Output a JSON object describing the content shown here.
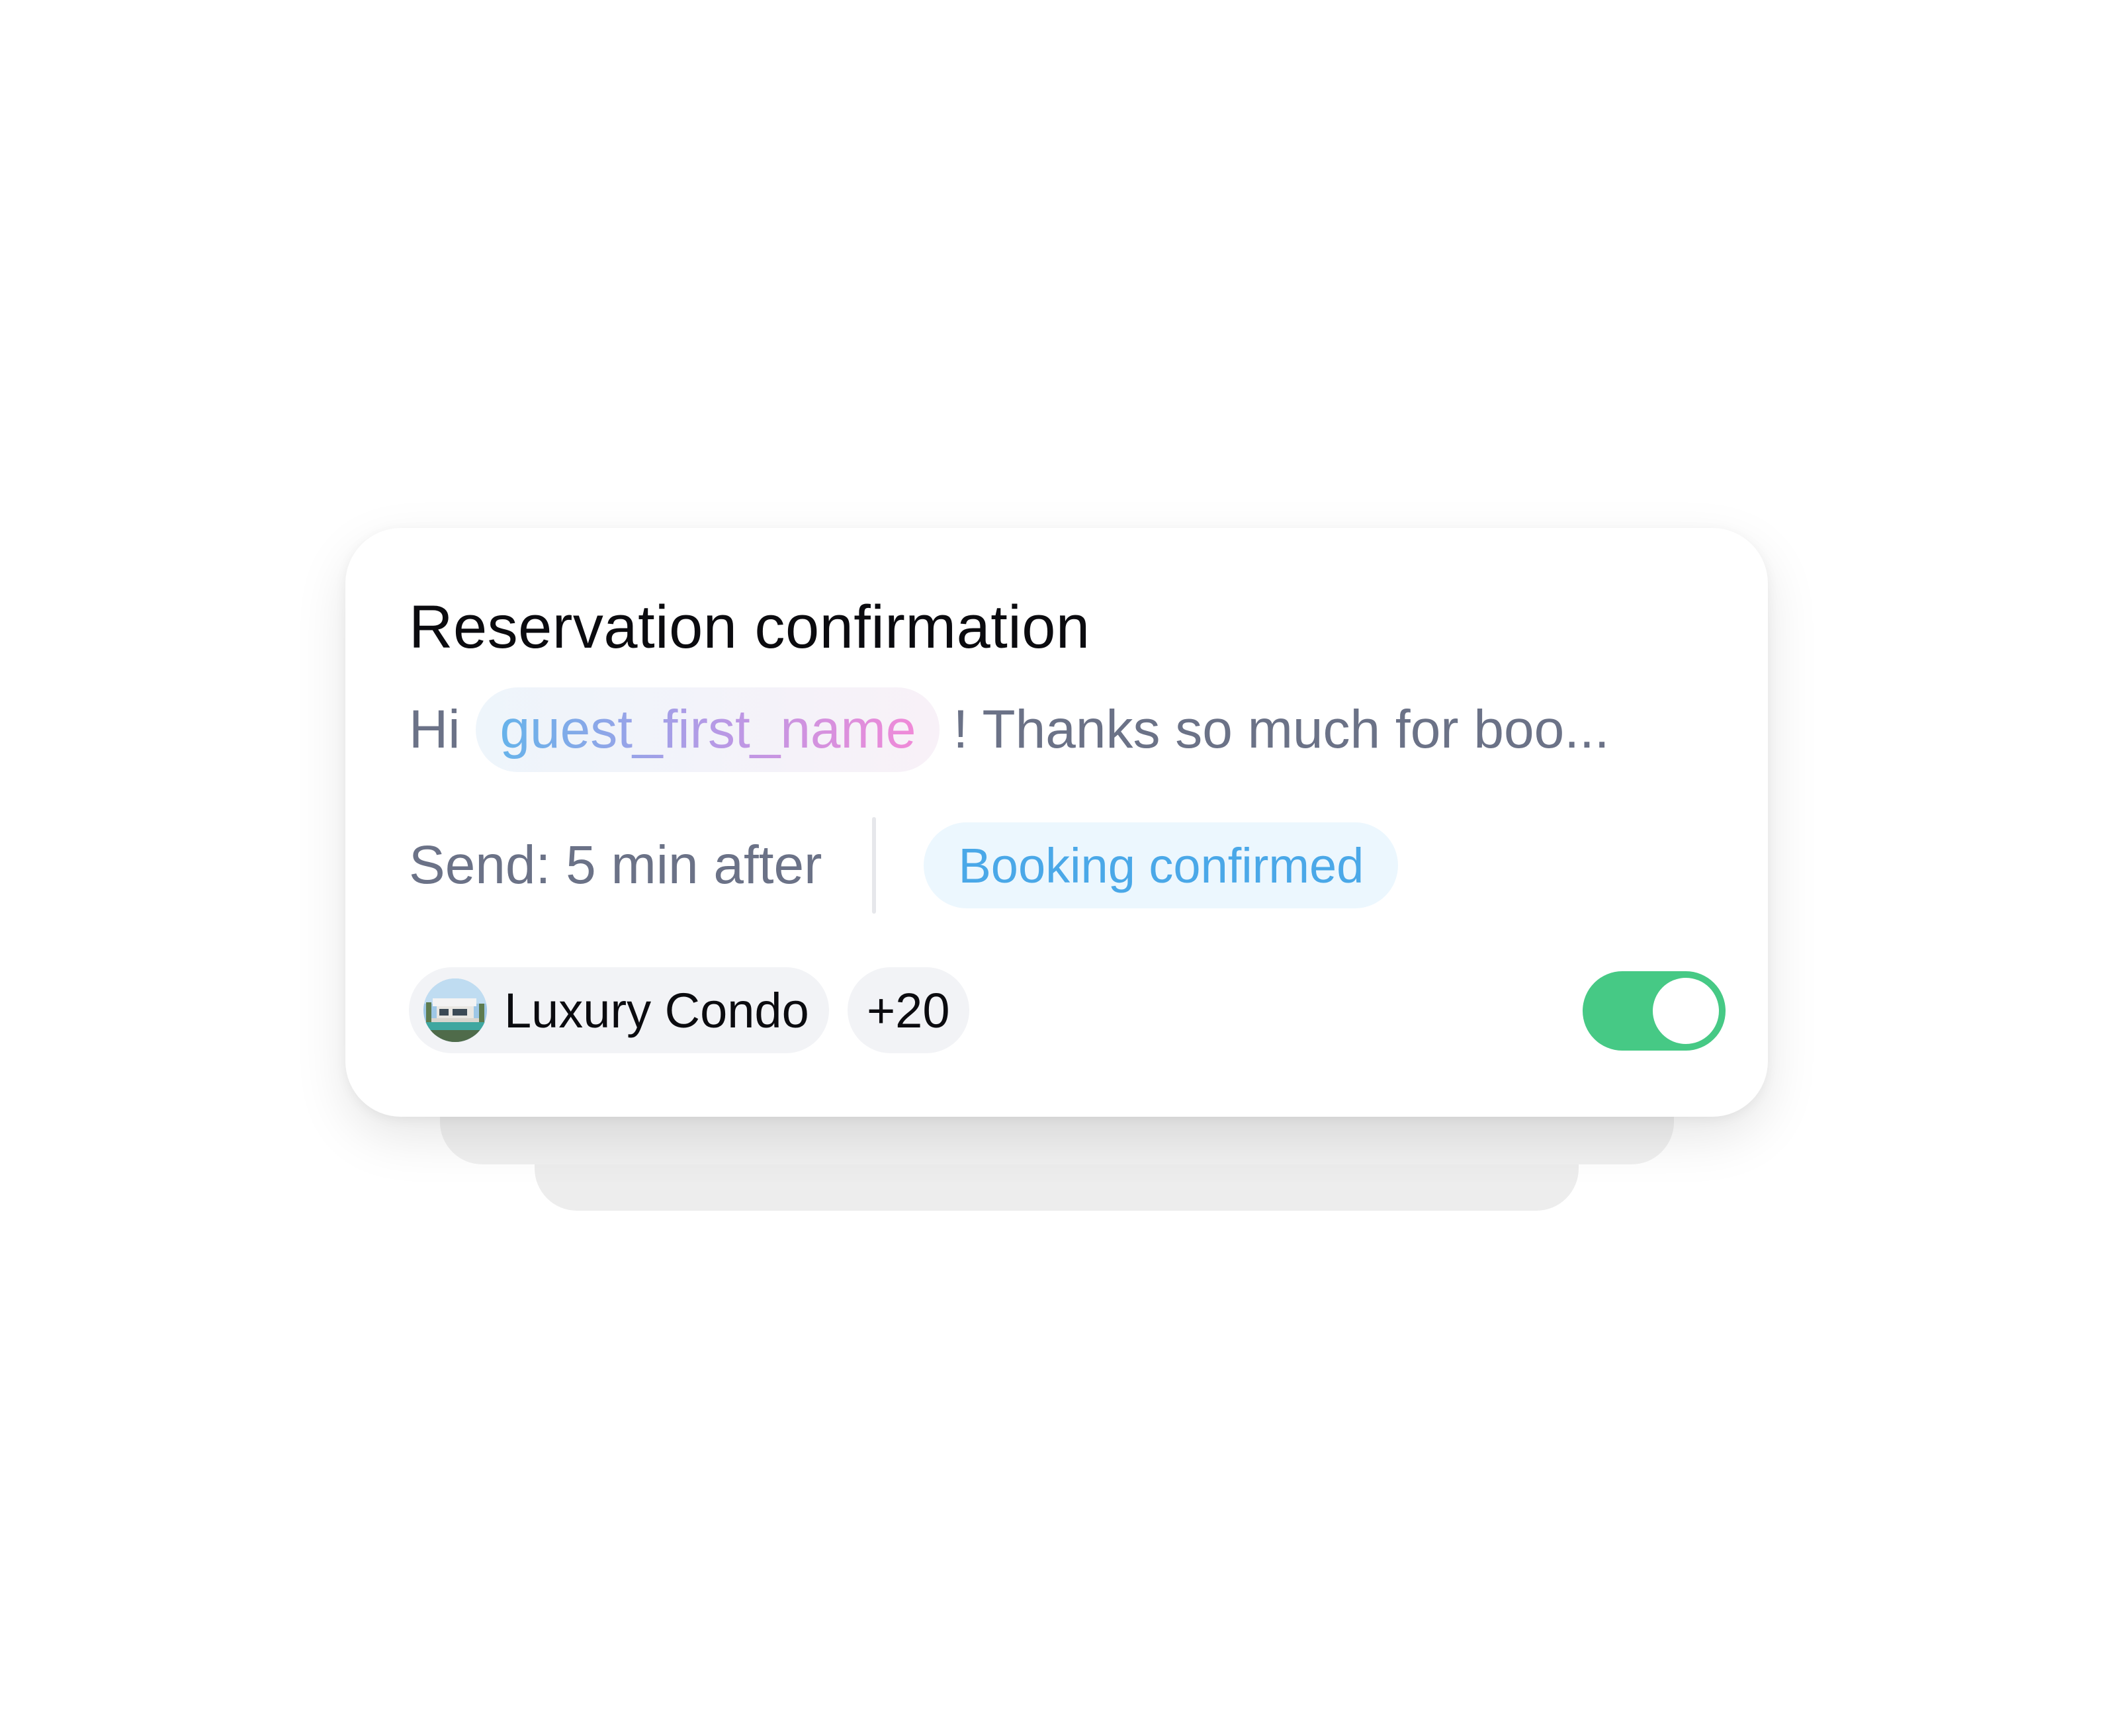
{
  "card": {
    "title": "Reservation confirmation",
    "preview": {
      "greeting": "Hi",
      "variable": "guest_first_name",
      "rest": "! Thanks so much for boo..."
    },
    "send_timing": "Send: 5 min after",
    "trigger": "Booking confirmed",
    "property": {
      "name": "Luxury Condo",
      "icon": "property-thumbnail-icon"
    },
    "extra_properties": "+20",
    "enabled": true
  },
  "colors": {
    "toggle_on": "#46c985",
    "trigger_text": "#4aa8e8",
    "trigger_bg": "#ecf7fe",
    "muted_text": "#6b7287",
    "title_text": "#0b0b0f"
  }
}
